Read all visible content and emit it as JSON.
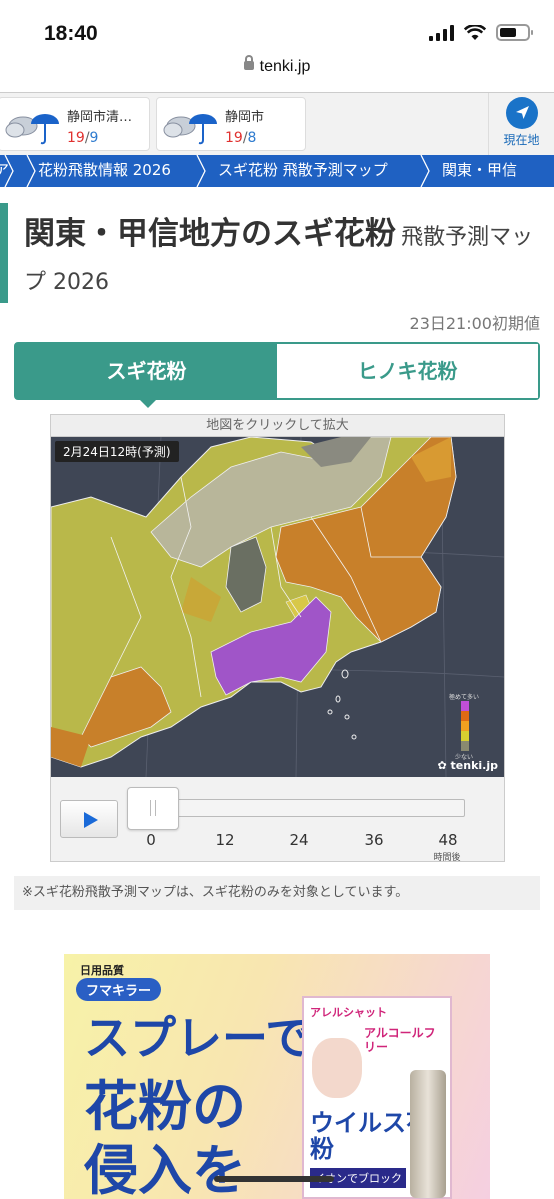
{
  "status": {
    "time": "18:40"
  },
  "browser": {
    "url": "tenki.jp"
  },
  "locations": [
    {
      "name": "静岡市清…",
      "high": "19",
      "low": "9",
      "weather_icon": "cloudy-rain-icon"
    },
    {
      "name": "静岡市",
      "high": "19",
      "low": "8",
      "weather_icon": "cloudy-rain-icon"
    }
  ],
  "current_location": {
    "label": "現在地",
    "icon": "navigation-arrow-icon"
  },
  "breadcrumbs": [
    "ア",
    "花粉飛散情報 2026",
    "スギ花粉 飛散予測マップ",
    "関東・甲信"
  ],
  "page": {
    "title": "関東・甲信地方のスギ花粉",
    "subtitle": "飛散予測マップ 2026",
    "init_time": "23日21:00初期値"
  },
  "tabs": [
    {
      "label": "スギ花粉",
      "active": true
    },
    {
      "label": "ヒノキ花粉",
      "active": false
    }
  ],
  "map": {
    "hint": "地図をクリックして拡大",
    "timestamp": "2月24日12時(予測)",
    "legend_top": "極めて多い",
    "legend_bottom": "少ない",
    "legend_colors": [
      "#c04fd8",
      "#e06a12",
      "#f0a020",
      "#d8d030",
      "#8a8a70"
    ],
    "logo": "tenki.jp"
  },
  "player": {
    "ticks": [
      "0",
      "12",
      "24",
      "36",
      "48"
    ],
    "unit": "時間後",
    "position_hours": 0
  },
  "note": "※スギ花粉飛散予測マップは、スギ花粉のみを対象としています。",
  "ad": {
    "brand_small": "日用品質",
    "brand": "フマキラー",
    "lines": [
      "スプレーで",
      "花粉の",
      "侵入を"
    ],
    "product_top": "アレルシャット",
    "product_tag": "アルコールフリー",
    "product_name": "ウイルス花粉",
    "product_sub": "イオンでブロック"
  }
}
